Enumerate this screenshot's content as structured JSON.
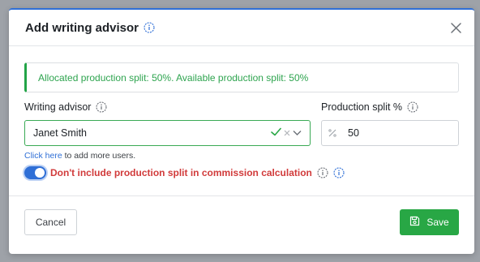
{
  "modal": {
    "title": "Add writing advisor",
    "title_info_icon": "info-icon",
    "close_icon": "close-icon"
  },
  "alert": {
    "text": "Allocated production split: 50%. Available production split: 50%"
  },
  "advisor": {
    "label": "Writing advisor",
    "selected": "Janet Smith",
    "icons": [
      "check-icon",
      "clear-icon",
      "chevron-down-icon"
    ]
  },
  "split": {
    "label": "Production split %",
    "value": "50"
  },
  "helper": {
    "link": "Click here",
    "text": " to add more users."
  },
  "toggle": {
    "on": true,
    "label": "Don't include production split in commission calculation"
  },
  "footer": {
    "cancel_label": "Cancel",
    "save_label": "Save"
  },
  "colors": {
    "accent": "#2f6fd6",
    "success": "#28a745",
    "danger": "#d13b3b"
  }
}
